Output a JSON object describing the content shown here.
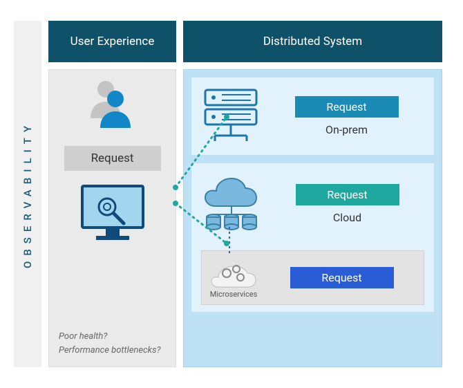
{
  "sidebar": {
    "label": "OBSERVABILITY"
  },
  "columns": {
    "ue": {
      "header": "User Experience"
    },
    "ds": {
      "header": "Distributed System"
    }
  },
  "ue": {
    "request_label": "Request",
    "footnote_line1": "Poor health?",
    "footnote_line2": "Performance bottlenecks?"
  },
  "ds": {
    "onprem": {
      "request_label": "Request",
      "sublabel": "On-prem"
    },
    "cloud": {
      "request_label": "Request",
      "sublabel": "Cloud"
    },
    "micro": {
      "request_label": "Request",
      "label": "Microservices"
    }
  },
  "colors": {
    "header": "#0f5168",
    "accent_blue": "#1386c7",
    "tag_onprem": "#1a8bb5",
    "tag_cloud": "#1fa8a0",
    "tag_micro": "#2a5cd6"
  }
}
